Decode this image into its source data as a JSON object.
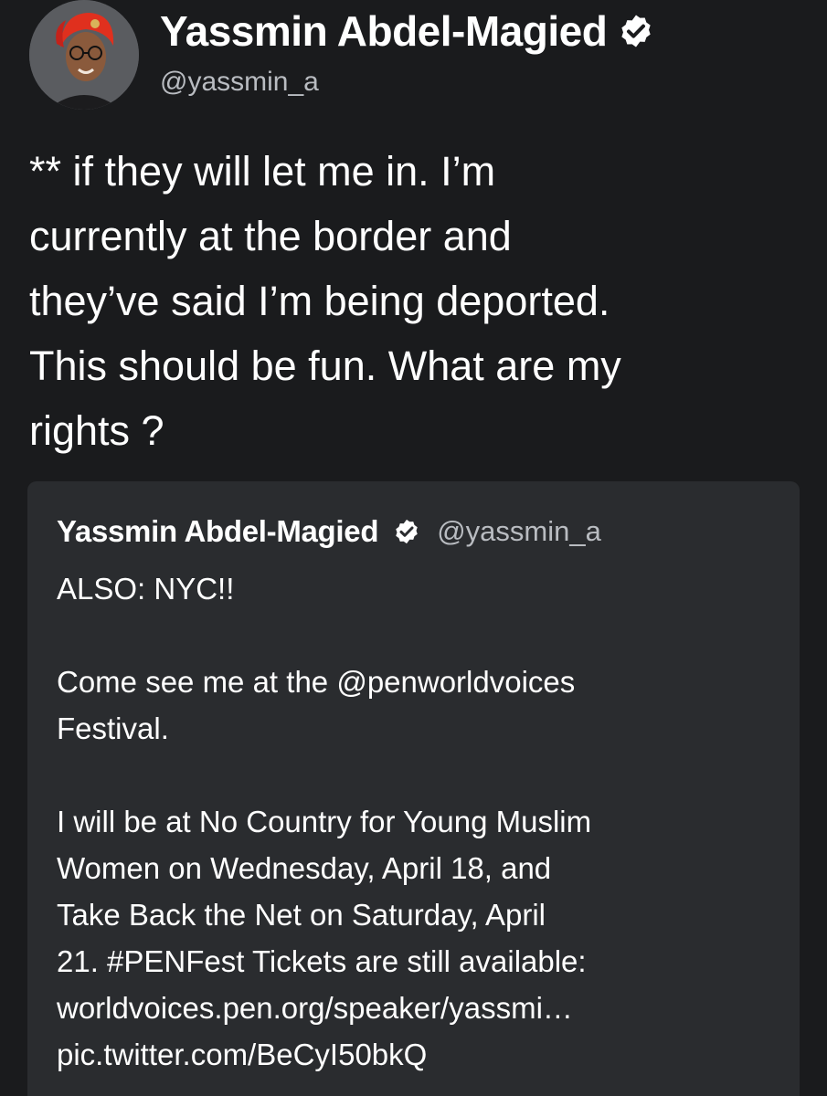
{
  "author": {
    "display_name": "Yassmin Abdel-Magied",
    "handle": "@yassmin_a",
    "verified_icon": "verified-badge-icon"
  },
  "tweet": {
    "text": "** if they will let me in. I’m\ncurrently at the border and\nthey’ve said I’m being deported.\nThis should be fun. What are my\nrights ?"
  },
  "quoted_tweet": {
    "display_name": "Yassmin Abdel-Magied",
    "handle": "@yassmin_a",
    "para1": "ALSO: NYC!!",
    "para2_line1": "Come see me at the @penworldvoices",
    "para2_line2": "Festival.",
    "para3_line1": "I will be at No Country for Young Muslim",
    "para3_line2": "Women on Wednesday, April 18, and",
    "para3_line3": "Take Back the Net on Saturday, April",
    "para3_line4": "21. #PENFest Tickets are still available:",
    "link": "worldvoices.pen.org/speaker/yassmi…",
    "pic_link": "pic.twitter.com/BeCyI50bkQ"
  },
  "colors": {
    "background": "#1a1b1d",
    "card": "#2a2c2f",
    "text": "#ffffff",
    "secondary_text": "#b9bcc1"
  }
}
